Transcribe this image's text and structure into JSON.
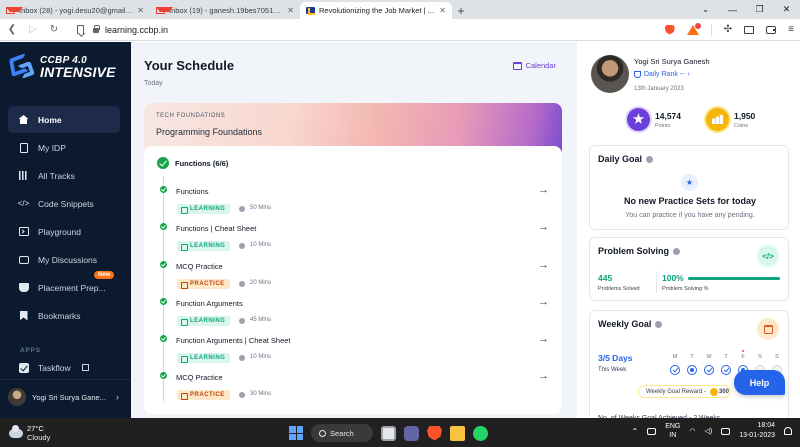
{
  "browser": {
    "tabs": [
      {
        "label": "Inbox (28) - yogi.desu20@gmail.com",
        "icon": "gmail-icon"
      },
      {
        "label": "Inbox (19) - ganesh.19bes7051@vitap...",
        "icon": "gmail-icon"
      },
      {
        "label": "Revolutionizing the Job Market | ...",
        "icon": "learning-portal-icon",
        "active": true
      }
    ],
    "url": "learning.ccbp.in",
    "brave_shield_count": "2"
  },
  "sidebar": {
    "logo_line1": "CCBP 4.0",
    "logo_line2": "INTENSIVE",
    "items": [
      {
        "label": "Home",
        "icon": "home-icon",
        "active": true
      },
      {
        "label": "My IDP",
        "icon": "document-icon"
      },
      {
        "label": "All Tracks",
        "icon": "tracks-icon"
      },
      {
        "label": "Code Snippets",
        "icon": "code-icon"
      },
      {
        "label": "Playground",
        "icon": "terminal-icon"
      },
      {
        "label": "My Discussions",
        "icon": "chat-icon"
      },
      {
        "label": "Placement Prep...",
        "icon": "briefcase-icon",
        "badge": "New"
      },
      {
        "label": "Bookmarks",
        "icon": "bookmark-icon"
      }
    ],
    "apps_title": "APPS",
    "apps": [
      {
        "label": "Taskflow",
        "icon": "taskflow-icon"
      }
    ],
    "user_name": "Yogi Sri Surya Gane..."
  },
  "main": {
    "title": "Your Schedule",
    "subtitle": "Today",
    "calendar_label": "Calendar",
    "banner": {
      "category": "TECH FOUNDATIONS",
      "name": "Programming Foundations"
    },
    "group_title": "Functions (6/6)",
    "items": [
      {
        "name": "Functions",
        "tag": "LEARNING",
        "duration": "50 Mins"
      },
      {
        "name": "Functions | Cheat Sheet",
        "tag": "LEARNING",
        "duration": "10 Mins"
      },
      {
        "name": "MCQ Practice",
        "tag": "PRACTICE",
        "duration": "20 Mins"
      },
      {
        "name": "Function Arguments",
        "tag": "LEARNING",
        "duration": "45 Mins"
      },
      {
        "name": "Function Arguments | Cheat Sheet",
        "tag": "LEARNING",
        "duration": "10 Mins"
      },
      {
        "name": "MCQ Practice",
        "tag": "PRACTICE",
        "duration": "30 Mins"
      }
    ]
  },
  "profile": {
    "name": "Yogi Sri Surya Ganesh",
    "rank_label": "Daily Rank --",
    "date": "13th January 2023",
    "points_value": "14,574",
    "points_label": "Points",
    "coins_value": "1,950",
    "coins_label": "Coins"
  },
  "daily_goal": {
    "title": "Daily Goal",
    "main": "No new Practice Sets for today",
    "sub": "You can practice if you have any pending."
  },
  "problem_solving": {
    "title": "Problem Solving",
    "solved_value": "445",
    "solved_label": "Problems Solved",
    "percent_value": "100%",
    "percent_label": "Problem Solving %",
    "progress": 1.0
  },
  "weekly_goal": {
    "title": "Weekly Goal",
    "days_value": "3/5 Days",
    "week_label": "This Week",
    "days": [
      {
        "label": "M",
        "state": "done"
      },
      {
        "label": "T",
        "state": "ring"
      },
      {
        "label": "W",
        "state": "done"
      },
      {
        "label": "T",
        "state": "done"
      },
      {
        "label": "F",
        "state": "ring",
        "today": true
      },
      {
        "label": "S",
        "state": "empty"
      },
      {
        "label": "S",
        "state": "empty"
      }
    ],
    "reward_label": "Weekly Goal Reward -",
    "reward_value": "300",
    "cut_text": "No. of Weeks Goal Achieved - 2 Weeks"
  },
  "help_label": "Help",
  "taskbar": {
    "temperature": "27°C",
    "weather": "Cloudy",
    "search_label": "Search",
    "lang_line1": "ENG",
    "lang_line2": "IN",
    "time": "18:04",
    "date": "13-01-2023"
  }
}
